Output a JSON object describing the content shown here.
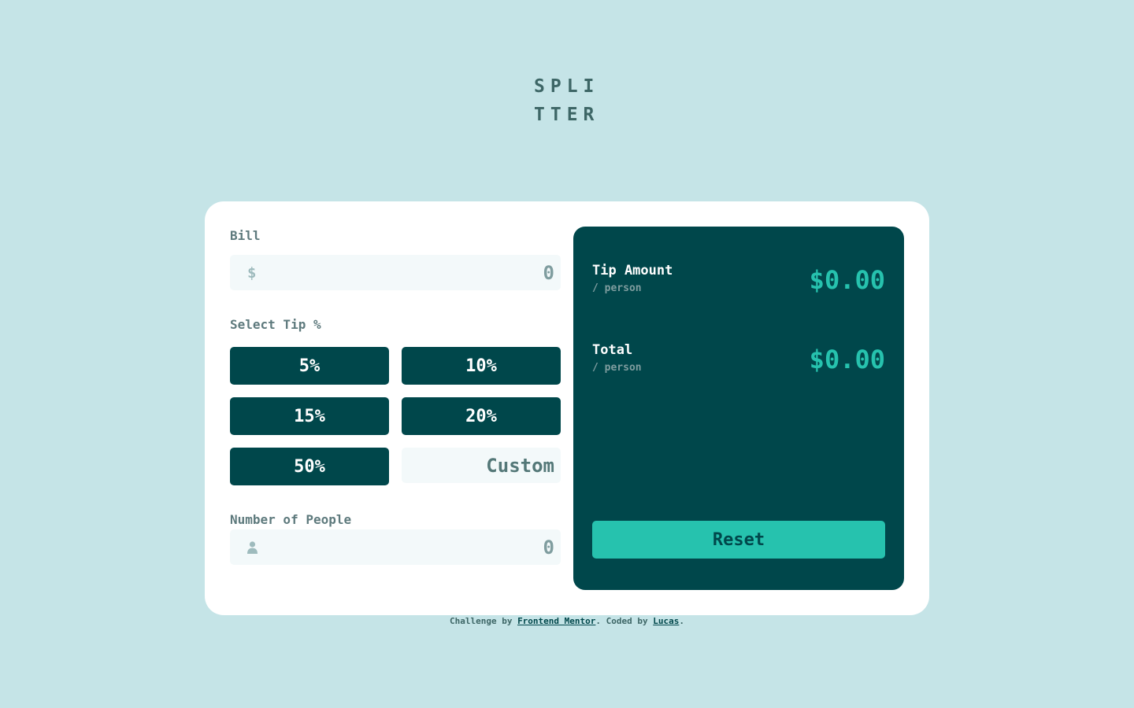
{
  "logo": {
    "line1": "SPLI",
    "line2": "TTER"
  },
  "form": {
    "bill": {
      "label": "Bill",
      "currency_symbol": "$",
      "placeholder": "0",
      "value": ""
    },
    "tip": {
      "label": "Select Tip %",
      "options": [
        "5%",
        "10%",
        "15%",
        "20%",
        "50%"
      ],
      "custom_placeholder": "Custom"
    },
    "people": {
      "label": "Number of People",
      "icon": "person-icon",
      "placeholder": "0",
      "value": ""
    }
  },
  "results": {
    "tip_amount": {
      "title": "Tip Amount",
      "subtitle": "/ person",
      "value": "$0.00"
    },
    "total": {
      "title": "Total",
      "subtitle": "/ person",
      "value": "$0.00"
    },
    "reset_label": "Reset"
  },
  "attribution": {
    "prefix": "Challenge by ",
    "link1": "Frontend Mentor",
    "middle": ". Coded by ",
    "link2": "Lucas",
    "suffix": "."
  },
  "colors": {
    "background": "#c5e4e7",
    "primary_dark": "#00474b",
    "accent": "#26c2ae",
    "input_bg": "#f3f9fa",
    "label_text": "#5e7a7d"
  }
}
